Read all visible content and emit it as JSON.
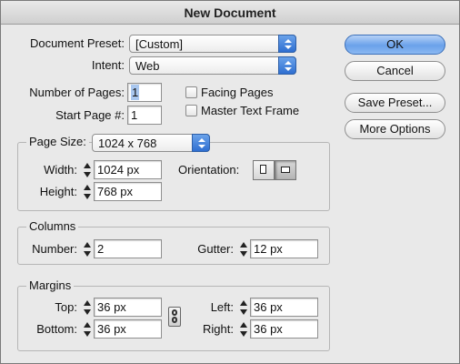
{
  "window": {
    "title": "New Document"
  },
  "preset": {
    "label": "Document Preset:",
    "value": "[Custom]"
  },
  "intent": {
    "label": "Intent:",
    "value": "Web"
  },
  "pages": {
    "num_label": "Number of Pages:",
    "num_value": "1",
    "start_label": "Start Page #:",
    "start_value": "1",
    "facing_label": "Facing Pages",
    "master_label": "Master Text Frame"
  },
  "page_size": {
    "label": "Page Size:",
    "value": "1024 x 768",
    "width_label": "Width:",
    "width_value": "1024 px",
    "height_label": "Height:",
    "height_value": "768 px",
    "orientation_label": "Orientation:"
  },
  "columns": {
    "title": "Columns",
    "number_label": "Number:",
    "number_value": "2",
    "gutter_label": "Gutter:",
    "gutter_value": "12 px"
  },
  "margins": {
    "title": "Margins",
    "top_label": "Top:",
    "top_value": "36 px",
    "bottom_label": "Bottom:",
    "bottom_value": "36 px",
    "left_label": "Left:",
    "left_value": "36 px",
    "right_label": "Right:",
    "right_value": "36 px"
  },
  "buttons": {
    "ok": "OK",
    "cancel": "Cancel",
    "save_preset": "Save Preset...",
    "more_options": "More Options"
  },
  "colors": {
    "accent": "#3a78d8",
    "window_bg": "#e9e9e9"
  }
}
